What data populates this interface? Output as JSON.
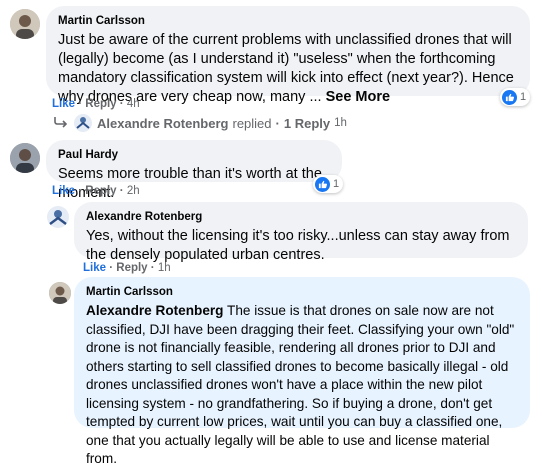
{
  "comments": [
    {
      "author": "Martin Carlsson",
      "text": "Just be aware of the current problems with unclassified drones that will (legally) become (as I understand it) \"useless\" when the forthcoming mandatory classification system will kick into effect (next year?). Hence why drones are very cheap now, many",
      "ellipsis": "...",
      "see_more": "See More",
      "like": "Like",
      "reply": "Reply",
      "time": "4h",
      "reactions": "1"
    },
    {
      "author": "Paul Hardy",
      "text": "Seems more trouble than it's worth at the moment.",
      "like": "Like",
      "reply": "Reply",
      "time": "2h",
      "reactions": "1"
    }
  ],
  "replies_summary": {
    "name": "Alexandre Rotenberg",
    "replied": "replied",
    "count_label": "1 Reply",
    "time": "1h"
  },
  "reply_comment": {
    "author": "Alexandre Rotenberg",
    "text": "Yes, without the licensing it's too risky...unless can stay away from the densely populated urban centres.",
    "like": "Like",
    "reply": "Reply",
    "time": "1h"
  },
  "highlighted_comment": {
    "author": "Martin Carlsson",
    "mention": "Alexandre Rotenberg",
    "text": "The issue is that drones on sale now are not classified, DJI have been dragging their feet. Classifying your own \"old\" drone is not financially feasible, rendering all drones prior to DJI and others starting to sell classified drones to become basically illegal - old drones unclassified drones won't have a place within the new pilot licensing system - no grandfathering. So if buying a drone, don't get tempted by current low prices, wait until you can buy a classified one, one that you actually legally will be able to use and license material from."
  },
  "separator": "·",
  "colors": {
    "like_blue": "#1877f2",
    "bubble": "#f0f2f5",
    "highlight": "#e7f3ff",
    "meta": "#65676b"
  }
}
